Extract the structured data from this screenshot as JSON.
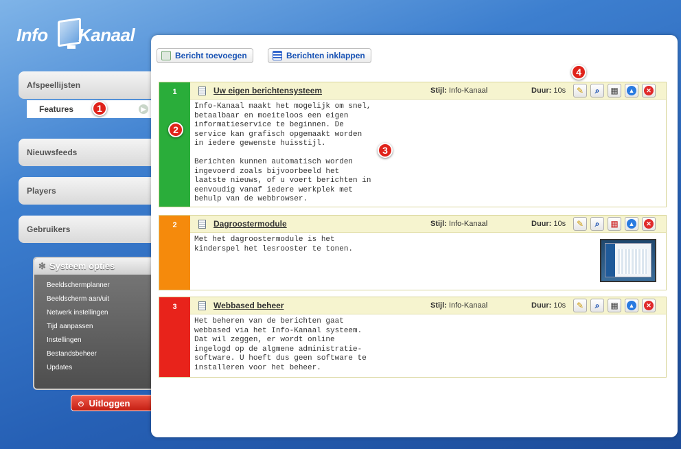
{
  "logo": {
    "part1": "Info",
    "part2": "Kanaal"
  },
  "sidebar": {
    "items": [
      {
        "label": "Afspeellijsten"
      },
      {
        "label": "Nieuwsfeeds"
      },
      {
        "label": "Players"
      },
      {
        "label": "Gebruikers"
      }
    ],
    "sub_item": {
      "label": "Features",
      "go_icon": "arrow-right-icon"
    }
  },
  "annotations": {
    "b1": "1",
    "b2": "2",
    "b3": "3",
    "b4": "4"
  },
  "system": {
    "title": "Systeem opties",
    "items": [
      "Beeldschermplanner",
      "Beeldscherm aan/uit",
      "Netwerk instellingen",
      "Tijd aanpassen",
      "Instellingen",
      "Bestandsbeheer",
      "Updates"
    ]
  },
  "logout": {
    "label": "Uitloggen",
    "icon": "power-icon"
  },
  "toolbar": {
    "add_label": "Bericht toevoegen",
    "collapse_label": "Berichten inklappen"
  },
  "labels": {
    "style": "Stijl:",
    "duration": "Duur:"
  },
  "messages": [
    {
      "num": "1",
      "color": "#2aad3a",
      "title": "Uw eigen berichtensysteem",
      "style": "Info-Kanaal",
      "duration": "10s",
      "body": "Info-Kanaal maakt het mogelijk om snel,\nbetaalbaar en moeiteloos een eigen\ninformatieservice te beginnen. De\nservice kan grafisch opgemaakt worden\nin iedere gewenste huisstijl.\n\nBerichten kunnen automatisch worden\ningevoerd zoals bijvoorbeeld het\nlaatste nieuws, of u voert berichten in\neenvoudig vanaf iedere werkplek met\nbehulp van de webbrowser."
    },
    {
      "num": "2",
      "color": "#f58a0c",
      "title": "Dagroostermodule",
      "style": "Info-Kanaal",
      "duration": "10s",
      "body": "Met het dagroostermodule is het\nkinderspel het lesrooster te tonen."
    },
    {
      "num": "3",
      "color": "#e8231b",
      "title": "Webbased beheer",
      "style": "Info-Kanaal",
      "duration": "10s",
      "body": "Het beheren van de berichten gaat\nwebbased via het Info-Kanaal systeem.\nDat wil zeggen, er wordt online\ningelogd op de algmene administratie-\nsoftware. U hoeft dus geen software te\ninstalleren voor het beheer."
    }
  ]
}
